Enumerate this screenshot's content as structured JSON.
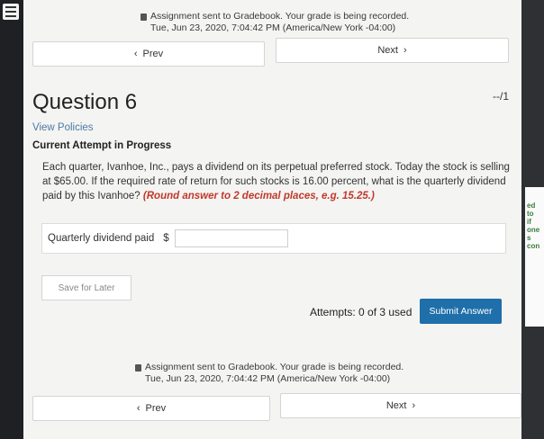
{
  "notice_top": {
    "line1": "Assignment sent to Gradebook. Your grade is being recorded.",
    "line2": "Tue, Jun 23, 2020, 7:04:42 PM (America/New York -04:00)"
  },
  "nav_top": {
    "prev": "Prev",
    "next": "Next"
  },
  "question": {
    "title": "Question 6",
    "score": "--/1",
    "view_policies": "View Policies",
    "attempt_label": "Current Attempt in Progress",
    "text": "Each quarter, Ivanhoe, Inc., pays a dividend on its perpetual preferred stock. Today the stock is selling at $65.00. If the required rate of return for such stocks is 16.00 percent, what is the quarterly dividend paid by this Ivanhoe?",
    "hint": "(Round answer to 2 decimal places, e.g. 15.25.)",
    "answer_label": "Quarterly dividend paid",
    "currency": "$",
    "answer_value": ""
  },
  "actions": {
    "save_later": "Save for Later",
    "attempts": "Attempts: 0 of 3 used",
    "submit": "Submit Answer"
  },
  "notice_bottom": {
    "line1": "Assignment sent to Gradebook. Your grade is being recorded.",
    "line2": "Tue, Jun 23, 2020, 7:04:42 PM (America/New York -04:00)"
  },
  "nav_bottom": {
    "prev": "Prev",
    "next": "Next"
  },
  "side_fragment": {
    "l1": "ed to",
    "l2": "if one",
    "l3": "s con"
  },
  "colors": {
    "submit": "#1f6faa",
    "hint": "#c0392b",
    "link": "#4d7aa6"
  }
}
